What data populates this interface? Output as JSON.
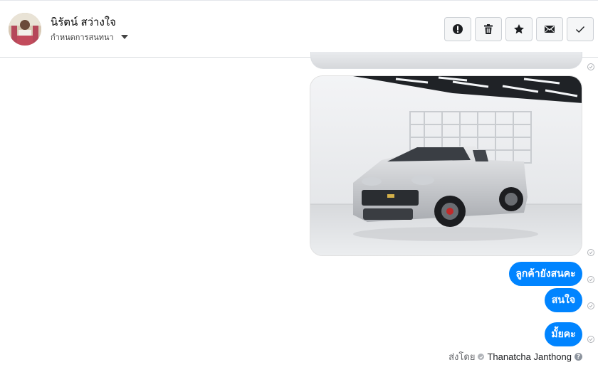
{
  "contact": {
    "name": "นิรัตน์ สว่างใจ",
    "conversation_label": "กำหนดการสนทนา"
  },
  "actions": [
    {
      "icon": "alert-icon",
      "name": "report-button"
    },
    {
      "icon": "trash-icon",
      "name": "delete-button"
    },
    {
      "icon": "star-icon",
      "name": "star-button"
    },
    {
      "icon": "envelope-icon",
      "name": "mark-unread-button"
    },
    {
      "icon": "check-icon",
      "name": "mark-done-button"
    }
  ],
  "messages": [
    {
      "text": "ลูกค้ายังสนคะ"
    },
    {
      "text": "สนใจ"
    },
    {
      "text": "มั้ยคะ"
    }
  ],
  "footer": {
    "sent_by_label": "ส่งโดย",
    "agent_name": "Thanatcha Janthong",
    "help_glyph": "?"
  },
  "colors": {
    "bubble": "#0084ff",
    "border": "#dddfe2"
  }
}
